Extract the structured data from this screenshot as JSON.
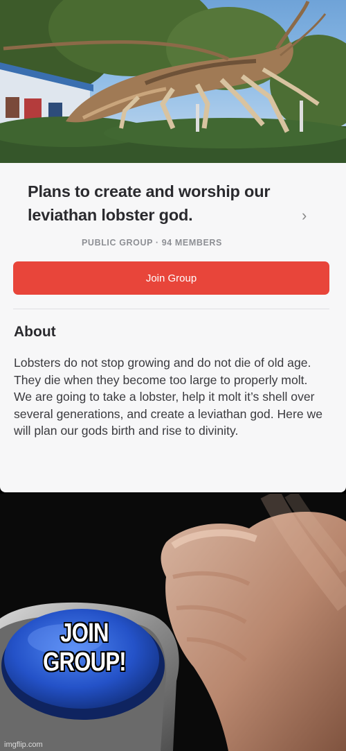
{
  "group": {
    "title": "Plans to create and worship our leviathan lobster god.",
    "chevron": "›",
    "meta": "PUBLIC GROUP · 94 MEMBERS",
    "join_label": "Join Group"
  },
  "about": {
    "heading": "About",
    "paragraph_1": "Lobsters do not stop growing and do not die of old age. They die when they become too large to properly molt.",
    "paragraph_2": "We are going to take a lobster, help it molt it’s shell over several generations, and create a leviathan god. Here we will plan our gods birth and rise to divinity."
  },
  "meme": {
    "caption": "JOIN GROUP!",
    "watermark": "imgflip.com"
  },
  "colors": {
    "join_button": "#e8453a",
    "card_background": "#f7f7f8",
    "button_blue": "#2f5fd8"
  },
  "icons": [
    "lobster-statue-photo",
    "chevron-right-icon",
    "blue-button-image",
    "hand-image"
  ]
}
